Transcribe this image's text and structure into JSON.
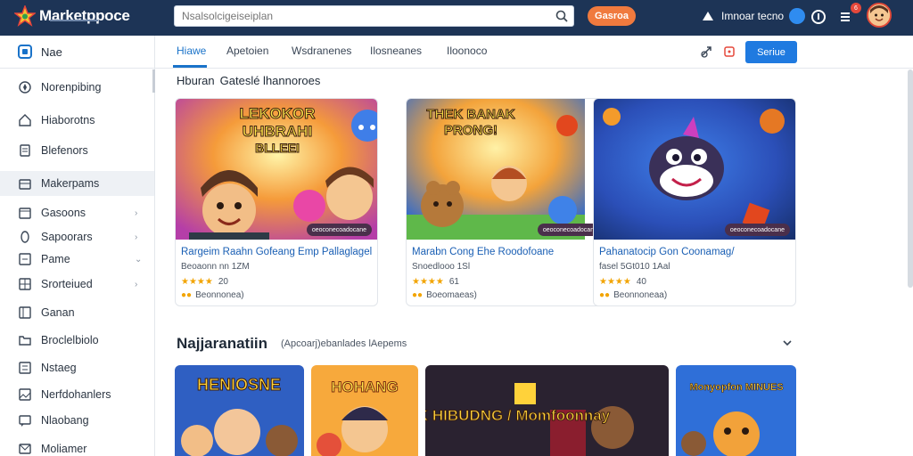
{
  "app": {
    "brand": "Marketppoce",
    "search_placeholder": "Nsalsolcigeiseiplan",
    "cta_label": "Gasroa",
    "user_label": "Imnoar tecno",
    "notification_count": "6"
  },
  "sidebar": {
    "header_label": "Nae",
    "items": [
      {
        "label": "Norenpibing",
        "icon": "compass-icon",
        "chevron": false
      },
      {
        "label": "Hiaborotns",
        "icon": "home-icon",
        "chevron": false
      },
      {
        "label": "Blefenors",
        "icon": "document-icon",
        "chevron": false
      },
      {
        "label": "Makerpams",
        "icon": "store-icon",
        "chevron": false,
        "active": true
      },
      {
        "label": "Gasoons",
        "icon": "calendar-icon",
        "chevron": true
      },
      {
        "label": "Sapoorars",
        "icon": "info-icon",
        "chevron": true
      },
      {
        "label": "Pame",
        "icon": "edit-icon",
        "chevron": true
      },
      {
        "label": "Srorteiued",
        "icon": "grid-icon",
        "chevron": true
      },
      {
        "label": "Ganan",
        "icon": "book-icon",
        "chevron": false
      },
      {
        "label": "Broclelbiolo",
        "icon": "folder-icon",
        "chevron": false
      },
      {
        "label": "Nstaeg",
        "icon": "list-icon",
        "chevron": false
      },
      {
        "label": "Nerfdohanlers",
        "icon": "image-icon",
        "chevron": false
      },
      {
        "label": "Nlaobang",
        "icon": "message-icon",
        "chevron": false
      },
      {
        "label": "Moliamer",
        "icon": "mail-icon",
        "chevron": false
      }
    ]
  },
  "tabs": [
    {
      "label": "Hiawe",
      "active": true
    },
    {
      "label": "Apetoien",
      "active": false
    },
    {
      "label": "Wsdranenes",
      "active": false
    },
    {
      "label": "Ilosneanes",
      "active": false
    },
    {
      "label": "Iloonoco",
      "active": false
    }
  ],
  "subbar": {
    "primary_label": "Seriue"
  },
  "section1": {
    "title": "Hburan",
    "subtitle": "Gateslé lhannoroes"
  },
  "cards": [
    {
      "art_text": [
        "LEKOKOR",
        "UHBRAHI",
        "BLLEEI"
      ],
      "tag": "oeoconecoadocane",
      "title": "Rargeim Raahn Gofeang Emp Pallaglagel",
      "meta": "Beoaonn nn  1ZM",
      "stars": "★★★★",
      "rating": "20",
      "extra": "Beonnonea)"
    },
    {
      "art_text": [
        "THEK BANAK",
        "PRONG!"
      ],
      "tag": "oeoconecoadocane",
      "title": "Marabn Cong Ehe Roodofoane",
      "meta": "Snoedlooo  1Sl",
      "stars": "★★★★",
      "rating": "61",
      "extra": "Boeomaeas)"
    },
    {
      "art_text": [],
      "tag": "oeoconecoadocane",
      "title": "Pahanatocip Gon Coonamag/",
      "meta": "fasel 5Gt010  1Aal",
      "stars": "★★★★",
      "rating": "40",
      "extra": "Beonnoneaa)"
    }
  ],
  "section2": {
    "title": "Najjaranatiin",
    "subtitle": "(Apcoarj)ebanlades lAepems"
  },
  "tiles": [
    {
      "art_text": "HENIOSNE"
    },
    {
      "art_text": "HOHANG"
    },
    {
      "art_text": "MANRBIK HIBUDNG / Momfoonnay"
    },
    {
      "art_text": "Monyopfon MINUES"
    }
  ],
  "colors": {
    "topbar": "#1d3456",
    "accent": "#1a73c9",
    "cta": "#f07a3e",
    "primary_button": "#1f7ae0"
  }
}
